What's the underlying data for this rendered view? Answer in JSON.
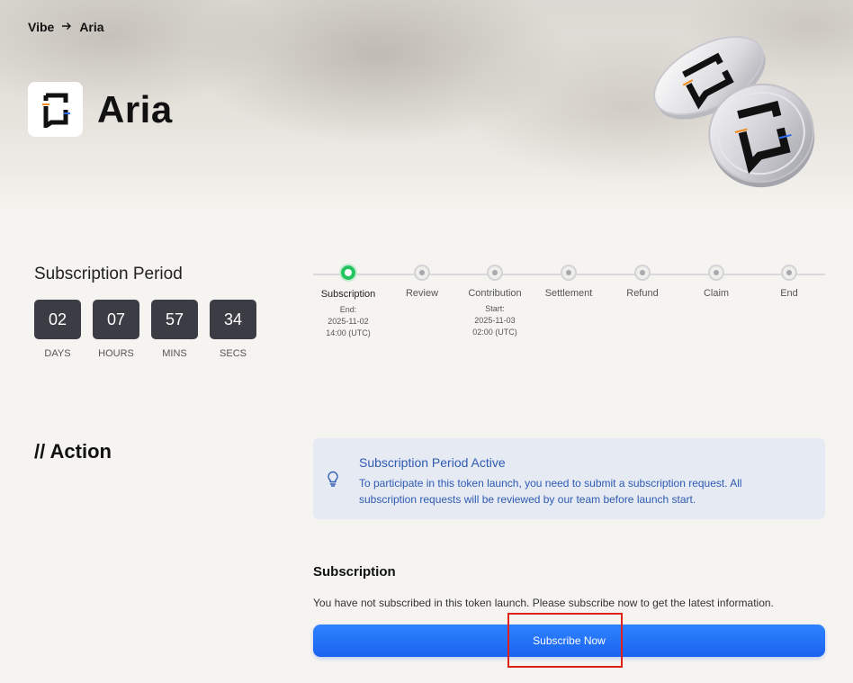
{
  "breadcrumb": {
    "parent": "Vibe",
    "separator_icon": "arrow-right-icon",
    "current": "Aria"
  },
  "project": {
    "name": "Aria",
    "logo_icon": "aria-logo-icon"
  },
  "subscription_period": {
    "title": "Subscription Period",
    "countdown": [
      {
        "value": "02",
        "label": "DAYS"
      },
      {
        "value": "07",
        "label": "HOURS"
      },
      {
        "value": "57",
        "label": "MINS"
      },
      {
        "value": "34",
        "label": "SECS"
      }
    ]
  },
  "timeline": {
    "active_index": 0,
    "steps": [
      {
        "label": "Subscription",
        "detail_1": "End:",
        "detail_2": "2025-11-02",
        "detail_3": "14:00 (UTC)"
      },
      {
        "label": "Review"
      },
      {
        "label": "Contribution",
        "detail_1": "Start:",
        "detail_2": "2025-11-03",
        "detail_3": "02:00 (UTC)"
      },
      {
        "label": "Settlement"
      },
      {
        "label": "Refund"
      },
      {
        "label": "Claim"
      },
      {
        "label": "End"
      }
    ]
  },
  "action": {
    "title": "// Action",
    "alert": {
      "icon": "lightbulb-icon",
      "title": "Subscription Period Active",
      "message": "To participate in this token launch, you need to submit a subscription request. All subscription requests will be reviewed by our team before launch start."
    },
    "subscription": {
      "heading": "Subscription",
      "message": "You have not subscribed in this token launch. Please subscribe now to get the latest information.",
      "button_label": "Subscribe Now"
    }
  },
  "colors": {
    "accent_blue": "#1a63f0",
    "active_green": "#23c55e",
    "countdown_bg": "#3c3d44",
    "alert_bg": "#e5eaf3",
    "alert_text": "#2f5bb3",
    "highlight_red": "#e0211b"
  }
}
